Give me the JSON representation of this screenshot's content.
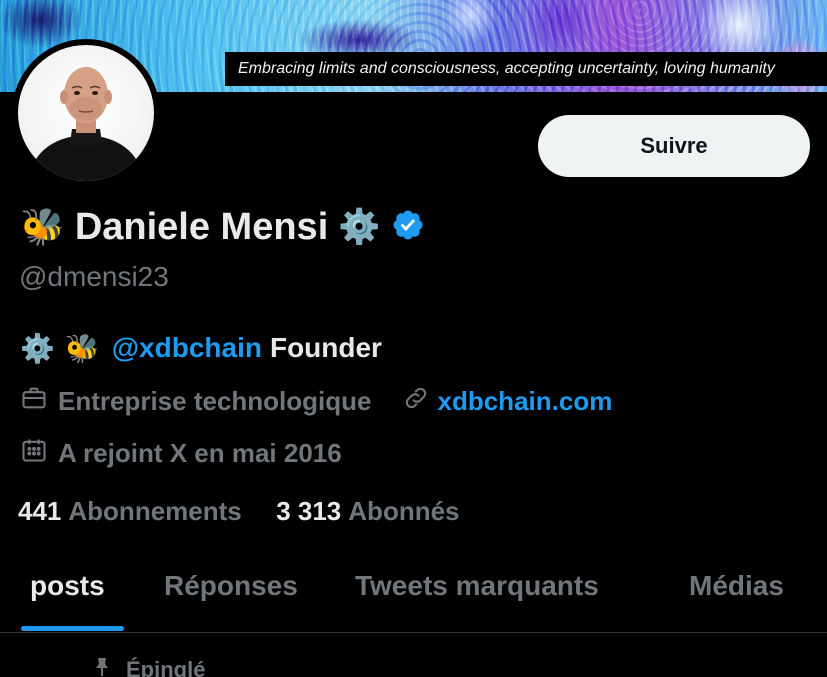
{
  "banner": {
    "caption": "Embracing limits and consciousness, accepting uncertainty, loving humanity"
  },
  "profile": {
    "name_prefix_emoji": "🐝",
    "display_name": "Daniele Mensi",
    "name_suffix_emoji": "⚙️",
    "handle": "@dmensi23",
    "verified": true,
    "follow_label": "Suivre",
    "bio": {
      "emoji_1": "⚙️",
      "emoji_2": "🐝",
      "mention": "@xdbchain",
      "rest": "Founder"
    },
    "category": "Entreprise technologique",
    "website": "xdbchain.com",
    "joined": "A rejoint X en mai 2016",
    "following_count": "441",
    "following_label": "Abonnements",
    "followers_count": "3 313",
    "followers_label": "Abonnés"
  },
  "tabs": [
    {
      "label": "posts",
      "active": true
    },
    {
      "label": "Réponses",
      "active": false
    },
    {
      "label": "Tweets marquants",
      "active": false
    },
    {
      "label": "Médias",
      "active": false
    }
  ],
  "pinned_label": "Épinglé",
  "colors": {
    "accent": "#1d9bf0",
    "text": "#e7e9ea",
    "muted": "#71767b",
    "background": "#000000",
    "button_bg": "#eff3f4"
  }
}
